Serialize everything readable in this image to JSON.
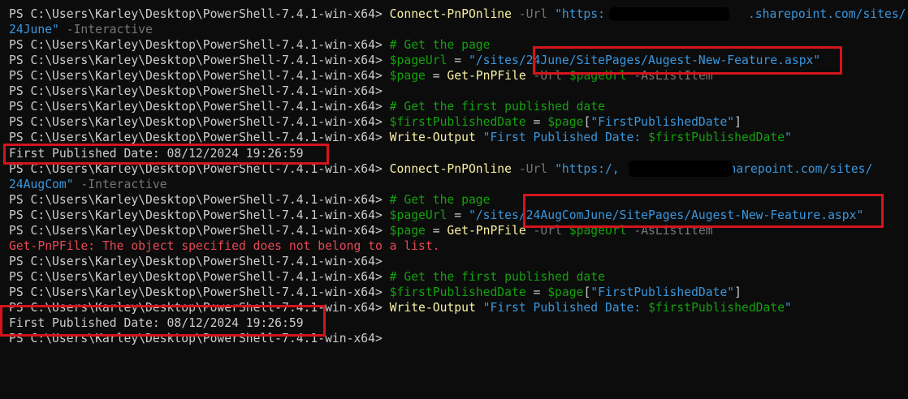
{
  "terminal": {
    "prompt": "PS C:\\Users\\Karley\\Desktop\\PowerShell-7.4.1-win-x64> ",
    "block1": {
      "connect_cmd": "Connect-PnPOnline",
      "url_param": " -Url ",
      "url_start": "\"https:",
      "url_end": ".sharepoint.com/sites/",
      "site_line2": "24June\"",
      "interactive": " -Interactive",
      "comment_get_page": "# Get the page",
      "page_url_var": "$pageUrl",
      "assign": " = ",
      "page_url_value": "\"/sites/24June/SitePages/Augest-New-Feature.aspx\"",
      "page_var": "$page",
      "get_file_cmd": "Get-PnPFile",
      "url_flag": " -Url ",
      "aslistitem": " -AsListItem",
      "comment_first_published": "# Get the first published date",
      "first_pub_var": "$firstPublishedDate",
      "field_open": "[",
      "field_name": "\"FirstPublishedDate\"",
      "field_close": "]",
      "write_cmd": "Write-Output",
      "write_str_a": " \"First Published Date: ",
      "write_str_b": "\"",
      "output_line": "First Published Date: 08/12/2024 19:26:59"
    },
    "block2": {
      "url_start": "\"https:/,",
      "url_end": "sharepoint.com/sites/",
      "site_line2": "24AugCom\"",
      "page_url_value": "\"/sites/24AugComJune/SitePages/Augest-New-Feature.aspx\"",
      "error_line": "Get-PnPFile: The object specified does not belong to a list.",
      "output_line": "First Published Date: 08/12/2024 19:26:59"
    }
  },
  "colors": {
    "background": "#0c0c0c",
    "text": "#cccccc",
    "command": "#f9f1a5",
    "string": "#3a96dd",
    "variable": "#13a10e",
    "parameter": "#767676",
    "error": "#e74856",
    "highlight_box": "#d4141c"
  }
}
